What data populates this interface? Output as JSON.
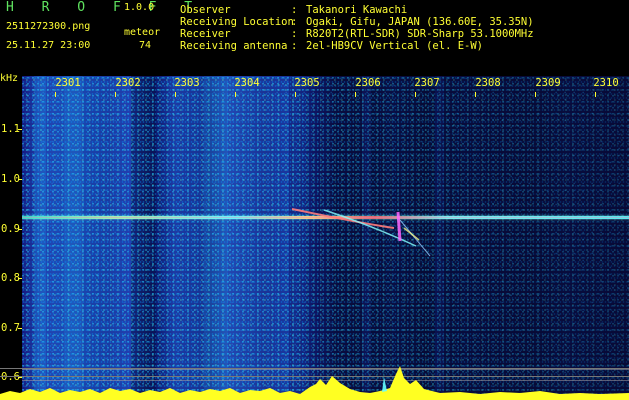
{
  "header": {
    "brand": "H R O F F T",
    "version": "1.0.0",
    "filename": "2511272300.png",
    "datetime": "25.11.27 23:00",
    "meteor_label": "meteor",
    "meteor_count": "74"
  },
  "meta": [
    {
      "label": "Observer",
      "value": "Takanori Kawachi"
    },
    {
      "label": "Receiving Location",
      "value": "Ogaki, Gifu, JAPAN (136.60E, 35.35N)"
    },
    {
      "label": "Receiver",
      "value": "R820T2(RTL-SDR) SDR-Sharp 53.1000MHz"
    },
    {
      "label": "Receiving antenna",
      "value": "2el-HB9CV Vertical (el. E-W)"
    }
  ],
  "axes": {
    "y_unit": "kHz",
    "x_ticks": [
      "2301",
      "2302",
      "2303",
      "2304",
      "2305",
      "2306",
      "2307",
      "2308",
      "2309",
      "2310"
    ],
    "y_ticks": [
      "1.1",
      "1.0",
      "0.9",
      "0.8",
      "0.7",
      "0.6"
    ]
  },
  "colors": {
    "label": "#ffff33",
    "brand": "#5fe35f",
    "background": "#000000"
  }
}
